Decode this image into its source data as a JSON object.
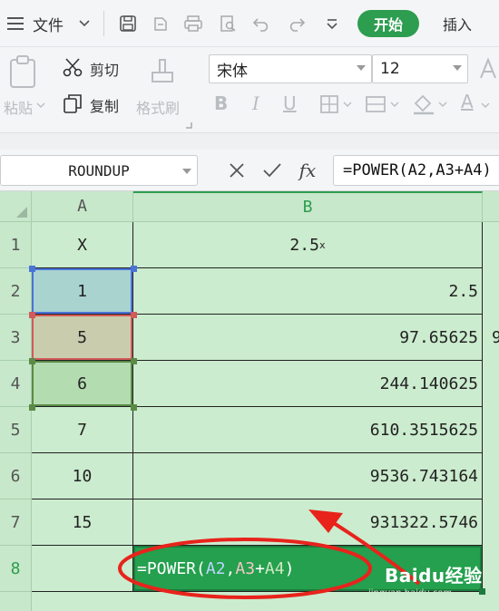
{
  "menubar": {
    "file_label": "文件",
    "tabs": {
      "start": "开始",
      "insert": "插入"
    }
  },
  "ribbon": {
    "paste_label": "粘贴",
    "cut_label": "剪切",
    "copy_label": "复制",
    "format_painter_label": "格式刷",
    "font_name": "宋体",
    "font_size": "12",
    "bold_label": "B",
    "italic_label": "I",
    "underline_label": "U",
    "font_color_label": "A"
  },
  "formula_bar": {
    "name_box": "ROUNDUP",
    "fx_label": "fx",
    "formula": "=POWER(A2,A3+A4)"
  },
  "sheet": {
    "columns": [
      "A",
      "B"
    ],
    "rows": [
      "1",
      "2",
      "3",
      "4",
      "5",
      "6",
      "7",
      "8"
    ],
    "header_row": {
      "a": "X",
      "b_base": "2.5",
      "b_exp": "x"
    },
    "a_values": [
      "1",
      "5",
      "6",
      "7",
      "10",
      "15"
    ],
    "b_values": [
      "2.5",
      "97.65625",
      "244.140625",
      "610.3515625",
      "9536.743164",
      "931322.5746"
    ],
    "c3_partial": "9",
    "editing_cell": {
      "prefix": "=POWER(",
      "ref1": "A2",
      "comma": ",",
      "ref2": "A3",
      "plus": "+",
      "ref3": "A4",
      "suffix": ")"
    }
  },
  "watermark": {
    "brand": "Baidu经验",
    "url": "jingyan.baidu.com"
  },
  "colors": {
    "accent": "#2d9d4f",
    "sheet_bg": "#cbecce",
    "ref_blue": "#4a73d8",
    "ref_red": "#d25a5a",
    "ref_green": "#5b8a46",
    "annotation_red": "#e8231c"
  }
}
